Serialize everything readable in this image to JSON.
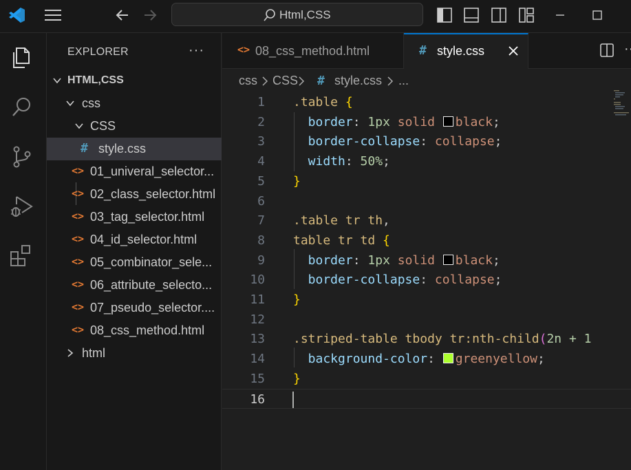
{
  "titlebar": {
    "search_text": "Html,CSS",
    "icons": [
      "vscode-logo-icon",
      "menu-icon",
      "back-arrow-icon",
      "forward-arrow-icon",
      "search-icon",
      "toggle-sidebar-icon",
      "toggle-panel-icon",
      "toggle-secondary-sidebar-icon",
      "customize-layout-icon",
      "minimize-icon",
      "maximize-icon"
    ]
  },
  "activitybar": {
    "items": [
      "explorer-icon",
      "search-icon",
      "source-control-icon",
      "run-debug-icon",
      "extensions-icon"
    ]
  },
  "sidebar": {
    "title": "EXPLORER",
    "more": "···",
    "tree": [
      {
        "label": "HTML,CSS",
        "type": "root",
        "expanded": true
      },
      {
        "label": "css",
        "type": "folder",
        "expanded": true
      },
      {
        "label": "CSS",
        "type": "folder",
        "expanded": true
      },
      {
        "label": "style.css",
        "type": "css-file",
        "selected": true
      },
      {
        "label": "01_univeral_selector...",
        "type": "html-file"
      },
      {
        "label": "02_class_selector.html",
        "type": "html-file"
      },
      {
        "label": "03_tag_selector.html",
        "type": "html-file"
      },
      {
        "label": "04_id_selector.html",
        "type": "html-file"
      },
      {
        "label": "05_combinator_sele...",
        "type": "html-file"
      },
      {
        "label": "06_attribute_selecto...",
        "type": "html-file"
      },
      {
        "label": "07_pseudo_selector....",
        "type": "html-file"
      },
      {
        "label": "08_css_method.html",
        "type": "html-file"
      },
      {
        "label": "html",
        "type": "folder",
        "expanded": false
      }
    ],
    "file_glyph_html": "<>",
    "file_glyph_css": "#"
  },
  "tabs": [
    {
      "label": "08_css_method.html",
      "glyph": "<>",
      "active": false
    },
    {
      "label": "style.css",
      "glyph": "#",
      "active": true
    }
  ],
  "breadcrumb": {
    "items": [
      "css",
      "CSS",
      "#",
      "style.css",
      "..."
    ]
  },
  "editor": {
    "lines": [
      {
        "n": "1",
        "tokens": [
          [
            "sel",
            ".table "
          ],
          [
            "brace",
            "{"
          ]
        ]
      },
      {
        "n": "2",
        "tokens": [
          [
            "prop",
            "  border"
          ],
          [
            "punc",
            ": "
          ],
          [
            "num",
            "1px"
          ],
          [
            "val",
            " solid "
          ],
          [
            "swatch",
            "#000000"
          ],
          [
            "val",
            "black"
          ],
          [
            "punc",
            ";"
          ]
        ]
      },
      {
        "n": "3",
        "tokens": [
          [
            "prop",
            "  border-collapse"
          ],
          [
            "punc",
            ": "
          ],
          [
            "val",
            "collapse"
          ],
          [
            "punc",
            ";"
          ]
        ]
      },
      {
        "n": "4",
        "tokens": [
          [
            "prop",
            "  width"
          ],
          [
            "punc",
            ": "
          ],
          [
            "num",
            "50%"
          ],
          [
            "punc",
            ";"
          ]
        ]
      },
      {
        "n": "5",
        "tokens": [
          [
            "brace",
            "}"
          ]
        ]
      },
      {
        "n": "6",
        "tokens": []
      },
      {
        "n": "7",
        "tokens": [
          [
            "sel",
            ".table tr th"
          ],
          [
            "punc",
            ","
          ]
        ]
      },
      {
        "n": "8",
        "tokens": [
          [
            "sel",
            "table tr td "
          ],
          [
            "brace",
            "{"
          ]
        ]
      },
      {
        "n": "9",
        "tokens": [
          [
            "prop",
            "  border"
          ],
          [
            "punc",
            ": "
          ],
          [
            "num",
            "1px"
          ],
          [
            "val",
            " solid "
          ],
          [
            "swatch",
            "#000000"
          ],
          [
            "val",
            "black"
          ],
          [
            "punc",
            ";"
          ]
        ]
      },
      {
        "n": "10",
        "tokens": [
          [
            "prop",
            "  border-collapse"
          ],
          [
            "punc",
            ": "
          ],
          [
            "val",
            "collapse"
          ],
          [
            "punc",
            ";"
          ]
        ]
      },
      {
        "n": "11",
        "tokens": [
          [
            "brace",
            "}"
          ]
        ]
      },
      {
        "n": "12",
        "tokens": []
      },
      {
        "n": "13",
        "tokens": [
          [
            "sel",
            ".striped-table tbody tr:nth-child"
          ],
          [
            "paren",
            "("
          ],
          [
            "num",
            "2n + 1"
          ]
        ]
      },
      {
        "n": "14",
        "tokens": [
          [
            "prop",
            "  background-color"
          ],
          [
            "punc",
            ": "
          ],
          [
            "swatch",
            "#adff2f"
          ],
          [
            "val",
            "greenyellow"
          ],
          [
            "punc",
            ";"
          ]
        ]
      },
      {
        "n": "15",
        "tokens": [
          [
            "brace",
            "}"
          ]
        ]
      },
      {
        "n": "16",
        "tokens": [],
        "current": true
      }
    ]
  },
  "colors": {
    "accent": "#0078d4",
    "html_icon": "#e37933",
    "css_icon": "#519aba",
    "selector": "#d7ba7d",
    "property": "#9cdcfe",
    "value": "#ce9178",
    "number": "#b5cea8",
    "brace": "#ffd700"
  }
}
